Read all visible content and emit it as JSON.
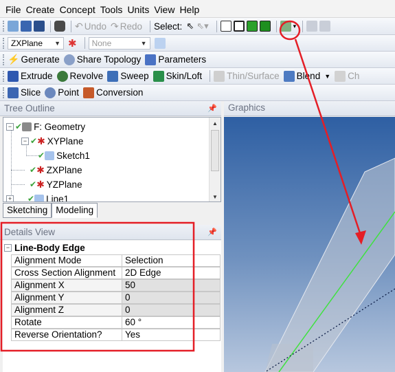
{
  "menu": [
    "File",
    "Create",
    "Concept",
    "Tools",
    "Units",
    "View",
    "Help"
  ],
  "toolbar1": {
    "undo": "Undo",
    "redo": "Redo",
    "select_label": "Select:"
  },
  "toolbar2": {
    "plane_value": "ZXPlane",
    "sketch_value": "None"
  },
  "toolbar3": {
    "generate": "Generate",
    "share_topology": "Share Topology",
    "parameters": "Parameters"
  },
  "toolbar4": {
    "extrude": "Extrude",
    "revolve": "Revolve",
    "sweep": "Sweep",
    "skin_loft": "Skin/Loft",
    "thin_surface": "Thin/Surface",
    "blend": "Blend",
    "cut_off": "Ch"
  },
  "toolbar5": {
    "slice": "Slice",
    "point": "Point",
    "conversion": "Conversion"
  },
  "tree": {
    "header": "Tree Outline",
    "items": [
      {
        "label": "F: Geometry"
      },
      {
        "label": "XYPlane"
      },
      {
        "label": "Sketch1"
      },
      {
        "label": "ZXPlane"
      },
      {
        "label": "YZPlane"
      },
      {
        "label": "Line1"
      }
    ],
    "tabs": [
      "Sketching",
      "Modeling"
    ]
  },
  "details": {
    "header": "Details View",
    "group": "Line-Body Edge",
    "rows": [
      {
        "key": "Alignment Mode",
        "value": "Selection"
      },
      {
        "key": "Cross Section Alignment",
        "value": "2D Edge"
      },
      {
        "key": "Alignment X",
        "value": "50"
      },
      {
        "key": "Alignment Y",
        "value": "0"
      },
      {
        "key": "Alignment Z",
        "value": "0"
      },
      {
        "key": "Rotate",
        "value": "60 °"
      },
      {
        "key": "Reverse Orientation?",
        "value": "Yes"
      }
    ]
  },
  "graphics": {
    "header": "Graphics"
  },
  "colors": {
    "highlight_red": "#e41e26",
    "edge_green": "#3fe23f",
    "beam_gray": "#c6ccd6"
  }
}
